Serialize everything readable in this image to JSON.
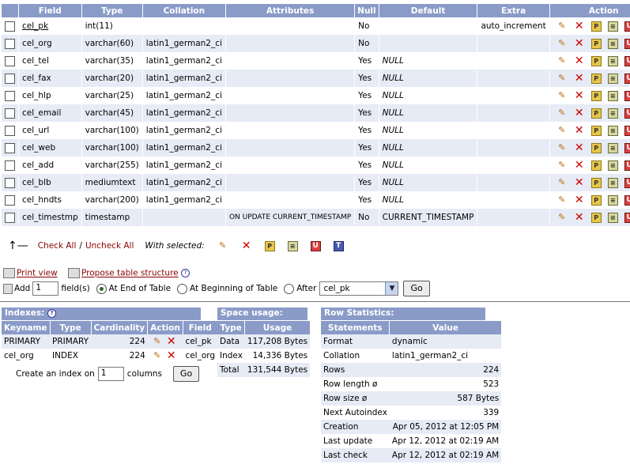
{
  "structure": {
    "headers": [
      "Field",
      "Type",
      "Collation",
      "Attributes",
      "Null",
      "Default",
      "Extra",
      "Action"
    ],
    "rows": [
      {
        "field": "cel_pk",
        "type": "int(11)",
        "collation": "",
        "attributes": "",
        "null": "No",
        "default": "",
        "extra": "auto_increment"
      },
      {
        "field": "cel_org",
        "type": "varchar(60)",
        "collation": "latin1_german2_ci",
        "attributes": "",
        "null": "No",
        "default": "",
        "extra": ""
      },
      {
        "field": "cel_tel",
        "type": "varchar(35)",
        "collation": "latin1_german2_ci",
        "attributes": "",
        "null": "Yes",
        "default": "NULL",
        "extra": ""
      },
      {
        "field": "cel_fax",
        "type": "varchar(20)",
        "collation": "latin1_german2_ci",
        "attributes": "",
        "null": "Yes",
        "default": "NULL",
        "extra": ""
      },
      {
        "field": "cel_hlp",
        "type": "varchar(25)",
        "collation": "latin1_german2_ci",
        "attributes": "",
        "null": "Yes",
        "default": "NULL",
        "extra": ""
      },
      {
        "field": "cel_email",
        "type": "varchar(45)",
        "collation": "latin1_german2_ci",
        "attributes": "",
        "null": "Yes",
        "default": "NULL",
        "extra": ""
      },
      {
        "field": "cel_url",
        "type": "varchar(100)",
        "collation": "latin1_german2_ci",
        "attributes": "",
        "null": "Yes",
        "default": "NULL",
        "extra": ""
      },
      {
        "field": "cel_web",
        "type": "varchar(100)",
        "collation": "latin1_german2_ci",
        "attributes": "",
        "null": "Yes",
        "default": "NULL",
        "extra": ""
      },
      {
        "field": "cel_add",
        "type": "varchar(255)",
        "collation": "latin1_german2_ci",
        "attributes": "",
        "null": "Yes",
        "default": "NULL",
        "extra": ""
      },
      {
        "field": "cel_blb",
        "type": "mediumtext",
        "collation": "latin1_german2_ci",
        "attributes": "",
        "null": "Yes",
        "default": "NULL",
        "extra": ""
      },
      {
        "field": "cel_hndts",
        "type": "varchar(200)",
        "collation": "latin1_german2_ci",
        "attributes": "",
        "null": "Yes",
        "default": "NULL",
        "extra": ""
      },
      {
        "field": "cel_timestmp",
        "type": "timestamp",
        "collation": "",
        "attributes": "ON UPDATE CURRENT_TIMESTAMP",
        "null": "No",
        "default": "CURRENT_TIMESTAMP",
        "extra": ""
      }
    ]
  },
  "with_selected": {
    "check_all": "Check All",
    "divider": "/",
    "uncheck_all": "Uncheck All",
    "label": "With selected:"
  },
  "tools": {
    "print_view": "Print view",
    "propose": "Propose table structure"
  },
  "add_field": {
    "add_label": "Add",
    "count": "1",
    "fields_label": "field(s)",
    "at_end": "At End of Table",
    "at_beginning": "At Beginning of Table",
    "after": "After",
    "after_selected": "cel_pk",
    "go": "Go"
  },
  "indexes": {
    "caption": "Indexes:",
    "headers": [
      "Keyname",
      "Type",
      "Cardinality",
      "Action",
      "Field"
    ],
    "rows": [
      {
        "keyname": "PRIMARY",
        "type": "PRIMARY",
        "cardinality": "224",
        "field": "cel_pk"
      },
      {
        "keyname": "cel_org",
        "type": "INDEX",
        "cardinality": "224",
        "field": "cel_org"
      }
    ],
    "create_label": "Create an index on",
    "create_count": "1",
    "columns_label": "columns",
    "go": "Go"
  },
  "space": {
    "caption": "Space usage:",
    "headers": [
      "Type",
      "Usage"
    ],
    "rows": [
      {
        "type": "Data",
        "usage": "117,208 Bytes"
      },
      {
        "type": "Index",
        "usage": "14,336 Bytes"
      },
      {
        "type": "Total",
        "usage": "131,544 Bytes"
      }
    ]
  },
  "rowstats": {
    "caption": "Row Statistics:",
    "headers": [
      "Statements",
      "Value"
    ],
    "rows": [
      {
        "s": "Format",
        "v": "dynamic",
        "align": "left"
      },
      {
        "s": "Collation",
        "v": "latin1_german2_ci",
        "align": "left"
      },
      {
        "s": "Rows",
        "v": "224",
        "align": "right"
      },
      {
        "s": "Row length ø",
        "v": "523",
        "align": "right"
      },
      {
        "s": "Row size  ø",
        "v": "587 Bytes",
        "align": "right"
      },
      {
        "s": "Next Autoindex",
        "v": "339",
        "align": "right"
      },
      {
        "s": "Creation",
        "v": "Apr 05, 2012 at 12:05 PM",
        "align": "right"
      },
      {
        "s": "Last update",
        "v": "Apr 12, 2012 at 02:19 AM",
        "align": "right"
      },
      {
        "s": "Last check",
        "v": "Apr 12, 2012 at 02:19 AM",
        "align": "right"
      }
    ]
  },
  "colors": {
    "header_bg": "#8a9bc8",
    "row_alt": "#e6ebf5",
    "link": "#8b0000"
  },
  "icons": [
    "pencil-icon",
    "drop-icon",
    "primary-icon",
    "index-icon",
    "unique-icon",
    "fulltext-icon",
    "help-icon",
    "print-icon"
  ]
}
